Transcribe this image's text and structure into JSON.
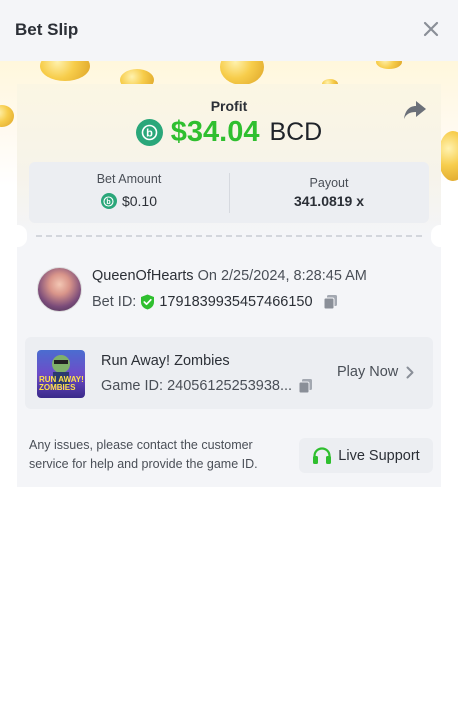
{
  "header": {
    "title": "Bet Slip"
  },
  "profit": {
    "label": "Profit",
    "amount": "$34.04",
    "currency": "BCD"
  },
  "bet_amount": {
    "label": "Bet Amount",
    "value": "$0.10"
  },
  "payout": {
    "label": "Payout",
    "value": "341.0819 x"
  },
  "user": {
    "name": "QueenOfHearts",
    "on_text": "On 2/25/2024, 8:28:45 AM"
  },
  "bet": {
    "id_label": "Bet ID:",
    "id_value": "1791839935457466150"
  },
  "game": {
    "name": "Run Away! Zombies",
    "id_label": "Game ID:",
    "id_value": "24056125253938...",
    "play_label": "Play Now",
    "thumb_text": "RUN AWAY! ZOMBIES"
  },
  "footer": {
    "issues_text": "Any issues, please contact the customer service for help and provide the game ID.",
    "support_label": "Live Support"
  },
  "colors": {
    "accent_green": "#2fbf2f",
    "bcd_green": "#2aa77a",
    "panel_bg": "#f4f5f8"
  },
  "icons": [
    "close-icon",
    "share-icon",
    "bcd-coin-icon",
    "verified-shield-icon",
    "copy-icon",
    "chevron-right-icon",
    "headset-icon"
  ]
}
